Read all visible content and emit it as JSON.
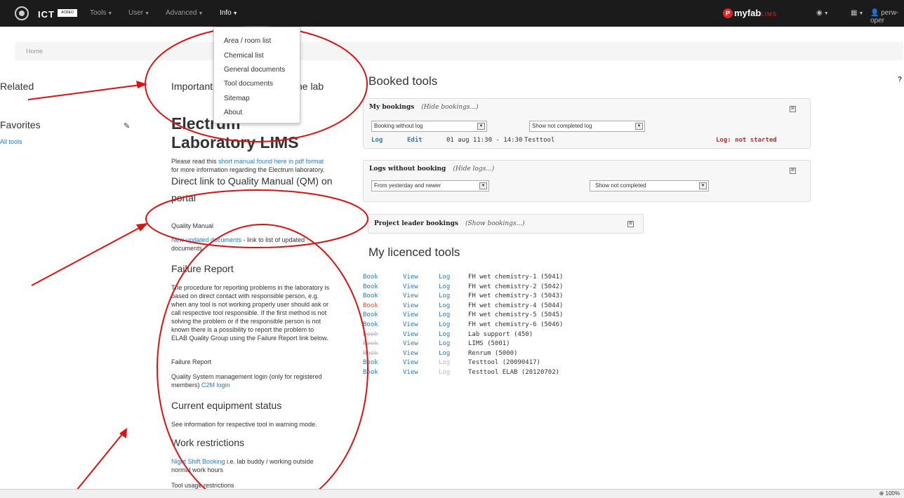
{
  "navbar": {
    "brand_acreo": "ACREO",
    "brand_ict": "ICT",
    "menus": [
      "Tools",
      "User",
      "Advanced",
      "Info"
    ],
    "myfab": "myfab",
    "lims": "LIMS",
    "user": "perw-oper"
  },
  "info_dropdown": [
    "Area / room list",
    "Chemical list",
    "General documents",
    "Tool documents",
    "Sitemap",
    "About"
  ],
  "breadcrumb": "Home",
  "sidebar": {
    "related": "Related",
    "favorites": "Favorites",
    "all_tools": "All tools"
  },
  "main": {
    "important": "Important information about the lab",
    "title_line1": "Electrum",
    "title_line2": "Laboratory LIMS",
    "intro_prefix": "Please read this ",
    "intro_link": "short manual found here in pdf format",
    "intro_suffix": "for more information regarding the Electrum laboratory.",
    "qm_heading_line1": "Direct link to Quality Manual (QM) on",
    "qm_heading_line2": "portal",
    "qm_link": "Quality Manual",
    "new_docs_link": "New-updated documents",
    "new_docs_suffix": " - link to list of updated",
    "new_docs_suffix2": "documents",
    "failure_heading": "Failure Report",
    "failure_lines": [
      "The procedure for reporting problems in the laboratory is",
      "based on direct contact with responsible person, e.g.",
      "when any tool is not working properly user should ask or",
      "call respective tool responsible. If the first method is not",
      "solving the problem or if the responsible person is not",
      "known there is a possibility to report the problem to",
      "ELAB Quality Group using the Failure Report link below."
    ],
    "failure_link": "Failure Report",
    "qs_line1": "Quality System management login (only for registered",
    "qs_line2_prefix": "members) ",
    "qs_link": "C2M login",
    "equipment_heading": "Current equipment status",
    "equipment_link": "See information for respective tool in warning mode.",
    "restrictions_heading": "Work restrictions",
    "night_link": "Night Shift Booking",
    "night_suffix": " i.e. lab buddy / working outside",
    "night_line2": "normal work hours",
    "usage_link": "Tool usage restrictions"
  },
  "booked": {
    "heading": "Booked tools",
    "my_bookings": "My bookings",
    "hide_bookings": "(Hide bookings...)",
    "select1": "Booking without log",
    "select2": "Show not completed log",
    "log": "Log",
    "edit": "Edit",
    "date": "01 aug 11:30 - 14:30",
    "tool": "Testtool",
    "status": "Log: not started",
    "logs_without": "Logs without booking",
    "hide_logs": "(Hide logs...)",
    "select3": "From yesterday and newer",
    "select4": "Show not completed",
    "project_leader": "Project leader bookings",
    "show_bookings": "(Show bookings...)"
  },
  "licenced": {
    "heading": "My licenced tools",
    "book": "Book",
    "view": "View",
    "log": "Log",
    "tools": [
      {
        "name": "FH wet chemistry-1 (5041)",
        "book": "active",
        "log": "active"
      },
      {
        "name": "FH wet chemistry-2 (5042)",
        "book": "active",
        "log": "active"
      },
      {
        "name": "FH wet chemistry-3 (5043)",
        "book": "active",
        "log": "active"
      },
      {
        "name": "FH wet chemistry-4 (5044)",
        "book": "warning",
        "log": "active"
      },
      {
        "name": "FH wet chemistry-5 (5045)",
        "book": "active",
        "log": "active"
      },
      {
        "name": "FH wet chemistry-6 (5046)",
        "book": "active",
        "log": "active"
      },
      {
        "name": "Lab support (450)",
        "book": "disabled",
        "log": "active"
      },
      {
        "name": "LIMS (5001)",
        "book": "disabled",
        "log": "active"
      },
      {
        "name": "Renrum (5000)",
        "book": "disabled",
        "log": "active"
      },
      {
        "name": "Testtool (20090417)",
        "book": "active",
        "log": "disabled"
      },
      {
        "name": "Testtool ELAB (20120702)",
        "book": "active",
        "log": "disabled"
      }
    ]
  },
  "colors": {
    "link": "#2a7ac8",
    "warning": "#e8501e",
    "disabled": "#bbbbbb",
    "status_red": "#d8242a",
    "annotation": "#e01010"
  },
  "footer": {
    "zoom": "100%"
  }
}
